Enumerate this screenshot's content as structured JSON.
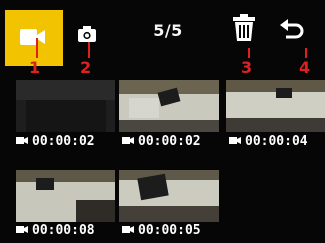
{
  "toolbar": {
    "counter": "5/5",
    "callouts": [
      "1",
      "2",
      "3",
      "4"
    ]
  },
  "thumbnails": [
    {
      "duration": "00:00:02"
    },
    {
      "duration": "00:00:02"
    },
    {
      "duration": "00:00:04"
    },
    {
      "duration": "00:00:08"
    },
    {
      "duration": "00:00:05"
    }
  ],
  "colors": {
    "accent": "#f2c300",
    "callout": "#e02020",
    "background": "#060606"
  },
  "icons": [
    "video-camera-icon",
    "camera-icon",
    "trash-icon",
    "back-arrow-icon"
  ]
}
